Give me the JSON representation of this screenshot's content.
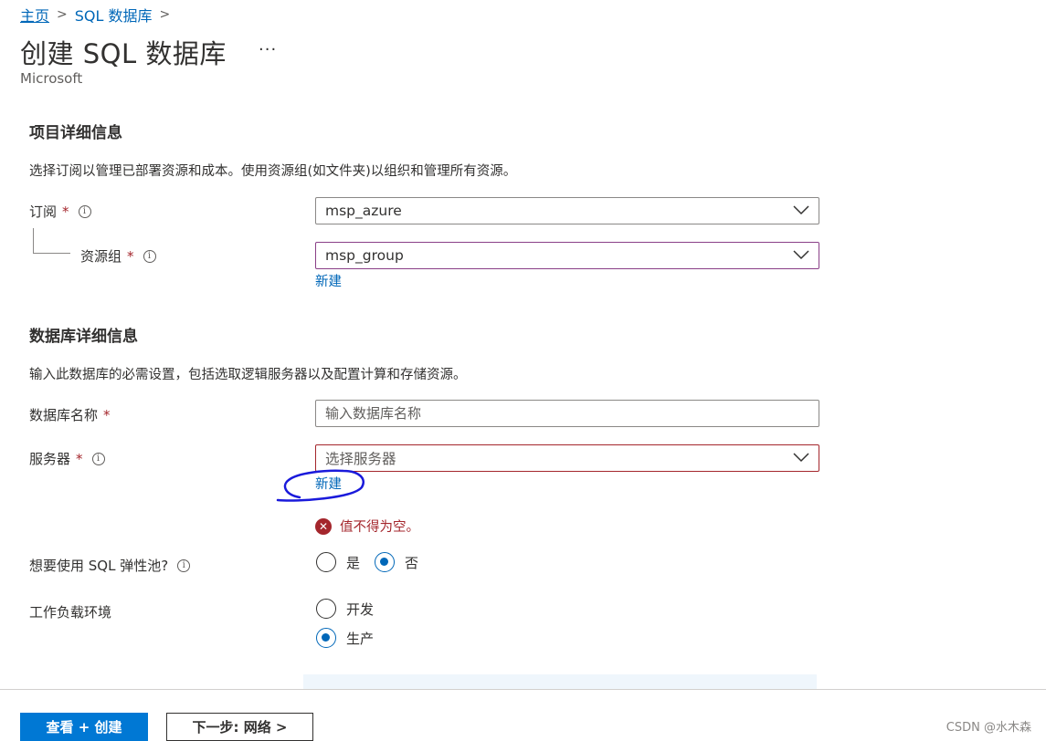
{
  "breadcrumb": {
    "home": "主页",
    "item": "SQL 数据库"
  },
  "page": {
    "title": "创建 SQL 数据库",
    "more": "···",
    "publisher": "Microsoft"
  },
  "project": {
    "title": "项目详细信息",
    "description": "选择订阅以管理已部署资源和成本。使用资源组(如文件夹)以组织和管理所有资源。",
    "subscription": {
      "label": "订阅",
      "required": "*",
      "value": "msp_azure"
    },
    "resource_group": {
      "label": "资源组",
      "required": "*",
      "value": "msp_group",
      "new_link": "新建"
    }
  },
  "database": {
    "title": "数据库详细信息",
    "description": "输入此数据库的必需设置，包括选取逻辑服务器以及配置计算和存储资源。",
    "db_name": {
      "label": "数据库名称",
      "required": "*",
      "value": "",
      "placeholder": "输入数据库名称"
    },
    "server": {
      "label": "服务器",
      "required": "*",
      "placeholder": "选择服务器",
      "new_link": "新建",
      "error": "值不得为空。"
    },
    "elastic_pool": {
      "label": "想要使用 SQL 弹性池?",
      "options": [
        "是",
        "否"
      ],
      "selected": "否"
    },
    "workload": {
      "label": "工作负载环境",
      "options": [
        "开发",
        "生产"
      ],
      "selected": "生产"
    }
  },
  "footer": {
    "review_button": "查看 + 创建",
    "next_button": "下一步: 网络 >",
    "watermark": "CSDN @水木森"
  },
  "colors": {
    "accent": "#0078d4",
    "link": "#0067b8",
    "error": "#a4262c",
    "annotation": "#1a1adb"
  },
  "icons": {
    "info": "info-icon",
    "chevron": "chevron-down-icon",
    "error": "error-icon"
  }
}
